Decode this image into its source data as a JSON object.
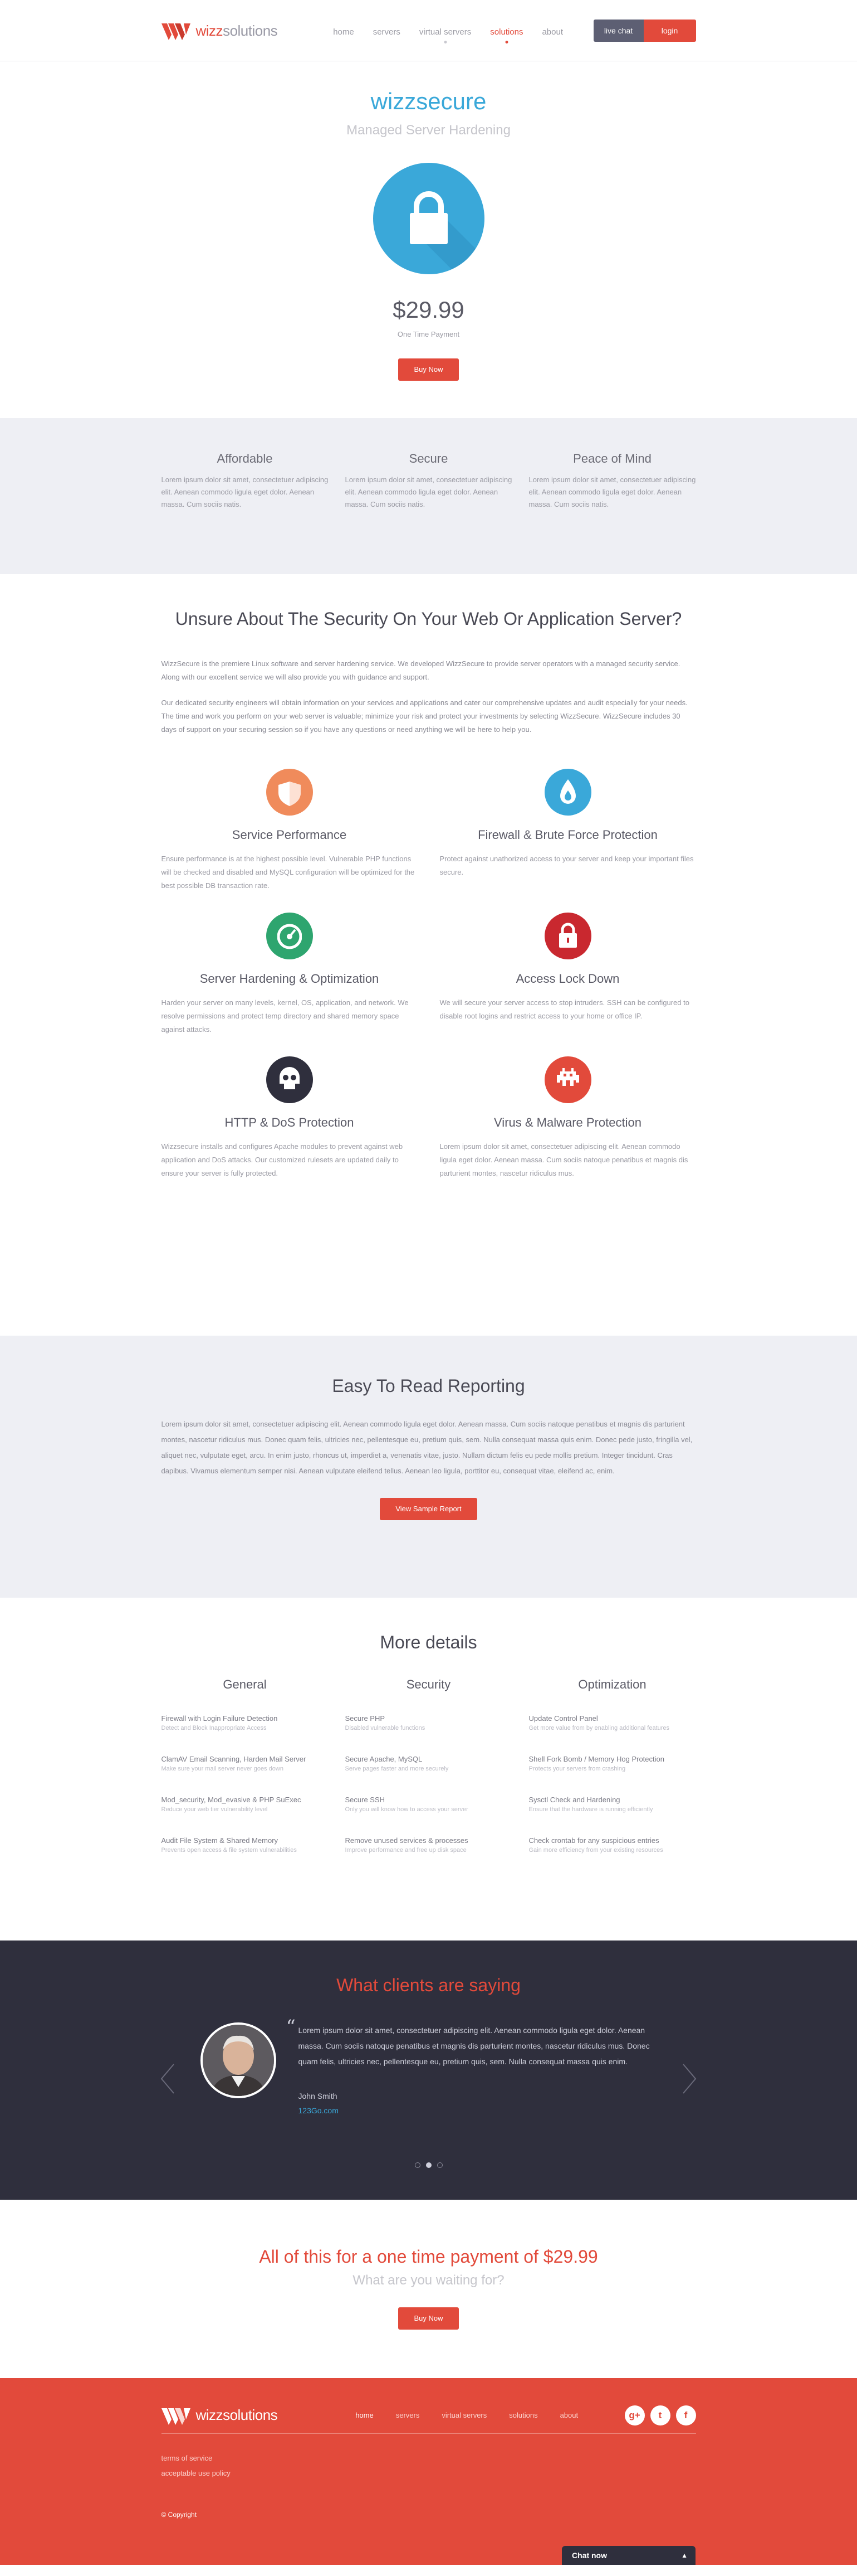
{
  "brand": {
    "name_a": "wizz",
    "name_b": "solutions"
  },
  "nav": [
    {
      "label": "home",
      "active": false
    },
    {
      "label": "servers",
      "active": false
    },
    {
      "label": "virtual servers",
      "active": false
    },
    {
      "label": "solutions",
      "active": true
    },
    {
      "label": "about",
      "active": false
    }
  ],
  "header_buttons": {
    "live_chat": "live chat",
    "login": "login"
  },
  "hero": {
    "title": "wizzsecure",
    "subtitle": "Managed Server Hardening",
    "price": "$29.99",
    "price_note": "One Time Payment",
    "buy": "Buy Now",
    "icon": "lock-icon"
  },
  "features": [
    {
      "title": "Affordable",
      "text": "Lorem ipsum dolor sit amet, consectetuer adipiscing elit. Aenean commodo ligula eget dolor. Aenean massa. Cum sociis natis."
    },
    {
      "title": "Secure",
      "text": "Lorem ipsum dolor sit amet, consectetuer adipiscing elit. Aenean commodo ligula eget dolor. Aenean massa. Cum sociis natis."
    },
    {
      "title": "Peace of Mind",
      "text": "Lorem ipsum dolor sit amet, consectetuer adipiscing elit. Aenean commodo ligula eget dolor. Aenean massa. Cum sociis natis."
    }
  ],
  "unsure": {
    "title": "Unsure About The Security On Your Web Or Application Server?",
    "p1": "WizzSecure is the premiere Linux software and server hardening service. We developed WizzSecure to provide server operators with a managed security service. Along with our excellent service we will also provide you with guidance and support.",
    "p2": "Our dedicated security engineers will obtain information on your services and applications and cater our comprehensive updates and audit especially for your needs. The time and work you perform on your web server is valuable; minimize your risk and protect your investments by selecting WizzSecure. WizzSecure includes 30 days of support on your securing session so if you have any questions or need anything we will be here to help you.",
    "services": [
      {
        "title": "Service Performance",
        "color": "#f08b5b",
        "icon": "shield-icon",
        "text": "Ensure performance is at the highest possible level. Vulnerable PHP functions will be checked and disabled and MySQL configuration will be optimized for the best possible DB transaction rate."
      },
      {
        "title": "Firewall & Brute Force Protection",
        "color": "#3aa8d9",
        "icon": "flame-icon",
        "text": "Protect against unathorized access to your server and keep your important files secure."
      },
      {
        "title": "Server Hardening & Optimization",
        "color": "#2ea56f",
        "icon": "gauge-icon",
        "text": "Harden your server on many levels, kernel, OS, application, and network. We resolve permissions and protect temp directory and shared memory space against attacks."
      },
      {
        "title": "Access Lock Down",
        "color": "#c9282f",
        "icon": "lock-icon",
        "text": "We will secure your server access to stop intruders. SSH can be configured to disable root logins and restrict access to your home or office IP."
      },
      {
        "title": "HTTP & DoS Protection",
        "color": "#2f2f3d",
        "icon": "skull-icon",
        "text": "Wizzsecure installs and configures Apache modules to prevent against web application and DoS attacks. Our customized rulesets are updated daily to ensure your server is fully protected."
      },
      {
        "title": "Virus & Malware Protection",
        "color": "#e24a3b",
        "icon": "invader-icon",
        "text": "Lorem ipsum dolor sit amet, consectetuer adipiscing elit. Aenean commodo ligula eget dolor. Aenean massa. Cum sociis natoque penatibus et magnis dis parturient montes, nascetur ridiculus mus."
      }
    ]
  },
  "report": {
    "title": "Easy To Read Reporting",
    "text": "Lorem ipsum dolor sit amet, consectetuer adipiscing elit. Aenean commodo ligula eget dolor. Aenean massa. Cum sociis natoque penatibus et magnis dis parturient montes, nascetur ridiculus mus. Donec quam felis, ultricies nec, pellentesque eu, pretium quis, sem. Nulla consequat massa quis enim. Donec pede justo, fringilla vel, aliquet nec, vulputate eget, arcu. In enim justo, rhoncus ut, imperdiet a, venenatis vitae, justo. Nullam dictum felis eu pede mollis pretium. Integer tincidunt. Cras dapibus. Vivamus elementum semper nisi. Aenean vulputate eleifend tellus. Aenean leo ligula, porttitor eu, consequat vitae, eleifend ac, enim.",
    "button": "View Sample Report"
  },
  "more": {
    "title": "More details",
    "columns": [
      {
        "title": "General",
        "items": [
          {
            "t": "Firewall with Login Failure Detection",
            "d": "Detect and Block Inappropriate Access"
          },
          {
            "t": "ClamAV Email Scanning, Harden Mail Server",
            "d": "Make sure your mail server never goes down"
          },
          {
            "t": "Mod_security, Mod_evasive & PHP SuExec",
            "d": "Reduce your web tier vulnerability level"
          },
          {
            "t": "Audit File System & Shared Memory",
            "d": "Prevents open access & file system vulnerabilities"
          }
        ]
      },
      {
        "title": "Security",
        "items": [
          {
            "t": "Secure PHP",
            "d": "Disabled vulnerable functions"
          },
          {
            "t": "Secure Apache, MySQL",
            "d": "Serve pages faster and more securely"
          },
          {
            "t": "Secure SSH",
            "d": "Only you will know how to access your server"
          },
          {
            "t": "Remove unused services & processes",
            "d": "Improve performance and free up disk space"
          }
        ]
      },
      {
        "title": "Optimization",
        "items": [
          {
            "t": "Update Control Panel",
            "d": "Get more value from by enabling additional features"
          },
          {
            "t": "Shell Fork Bomb / Memory Hog Protection",
            "d": "Protects your servers from crashing"
          },
          {
            "t": "Sysctl Check and Hardening",
            "d": "Ensure that the hardware is running efficiently"
          },
          {
            "t": "Check crontab for any suspicious entries",
            "d": "Gain more efficiency from your existing resources"
          }
        ]
      }
    ]
  },
  "testimonial": {
    "title": "What clients are saying",
    "quote": "Lorem ipsum dolor sit amet, consectetuer adipiscing elit. Aenean commodo ligula eget dolor. Aenean massa. Cum sociis natoque penatibus et magnis dis parturient montes, nascetur ridiculus mus. Donec quam felis, ultricies nec, pellentesque eu, pretium quis, sem. Nulla consequat massa quis enim.",
    "author": "John Smith",
    "link": "123Go.com",
    "slides": 3,
    "active_slide": 2
  },
  "cta": {
    "title": "All of this for a one time payment of $29.99",
    "subtitle": "What are you waiting for?",
    "button": "Buy Now"
  },
  "footer": {
    "nav": [
      {
        "label": "home",
        "active": true
      },
      {
        "label": "servers",
        "active": false
      },
      {
        "label": "virtual servers",
        "active": false
      },
      {
        "label": "solutions",
        "active": false
      },
      {
        "label": "about",
        "active": false
      }
    ],
    "links": [
      "terms of service",
      "acceptable use policy"
    ],
    "copyright": "© Copyright",
    "socials": [
      {
        "icon": "google-plus-icon",
        "glyph": "g+"
      },
      {
        "icon": "twitter-icon",
        "glyph": "t"
      },
      {
        "icon": "facebook-icon",
        "glyph": "f"
      }
    ],
    "chat": "Chat now"
  },
  "colors": {
    "brand_red": "#e24a3b",
    "brand_blue": "#3aa8d9",
    "dark": "#2f2f3d",
    "gray_bg": "#eeeff4"
  }
}
